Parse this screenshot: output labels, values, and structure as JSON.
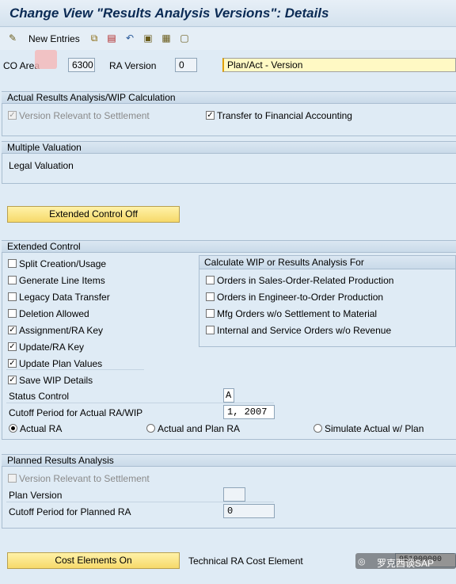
{
  "window": {
    "title": "Change View \"Results Analysis Versions\": Details"
  },
  "toolbar": {
    "new_entries_label": "New Entries",
    "icons": [
      "change-display-icon",
      "copy-icon",
      "delete-icon",
      "undo-icon",
      "select-all-icon",
      "select-block-icon",
      "deselect-icon"
    ]
  },
  "header": {
    "co_area_label": "CO Area",
    "co_area_value": "6300",
    "ra_version_label": "RA Version",
    "ra_version_value": "0",
    "version_desc": "Plan/Act - Version"
  },
  "actual_section": {
    "title": "Actual Results Analysis/WIP Calculation",
    "version_relevant_label": "Version Relevant to Settlement",
    "version_relevant_checked": true,
    "transfer_fi_label": "Transfer to Financial Accounting",
    "transfer_fi_checked": true
  },
  "multiple_valuation": {
    "title": "Multiple Valuation",
    "value": "Legal Valuation"
  },
  "extended_control_button": "Extended Control Off",
  "extended_control": {
    "title": "Extended Control",
    "items": [
      {
        "label": "Split Creation/Usage",
        "checked": false
      },
      {
        "label": "Generate Line Items",
        "checked": false
      },
      {
        "label": "Legacy Data Transfer",
        "checked": false
      },
      {
        "label": "Deletion Allowed",
        "checked": false
      },
      {
        "label": "Assignment/RA Key",
        "checked": true
      },
      {
        "label": "Update/RA Key",
        "checked": true
      },
      {
        "label": "Update Plan Values",
        "checked": true
      },
      {
        "label": "Save WIP Details",
        "checked": true
      }
    ],
    "calc_panel": {
      "title": "Calculate WIP or Results Analysis For",
      "items": [
        {
          "label": "Orders in Sales-Order-Related Production",
          "checked": false
        },
        {
          "label": "Orders in Engineer-to-Order Production",
          "checked": false
        },
        {
          "label": "Mfg Orders w/o Settlement to Material",
          "checked": false
        },
        {
          "label": "Internal and Service Orders w/o Revenue",
          "checked": false
        }
      ]
    },
    "status_control_label": "Status Control",
    "status_control_value": "A",
    "cutoff_label": "Cutoff Period for Actual RA/WIP",
    "cutoff_value": "1, 2007",
    "radios": [
      {
        "label": "Actual RA",
        "selected": true
      },
      {
        "label": "Actual and Plan RA",
        "selected": false
      },
      {
        "label": "Simulate Actual w/ Plan",
        "selected": false
      }
    ]
  },
  "planned_section": {
    "title": "Planned Results Analysis",
    "version_relevant_label": "Version Relevant to Settlement",
    "plan_version_label": "Plan Version",
    "plan_version_value": "",
    "cutoff_planned_label": "Cutoff Period for Planned RA",
    "cutoff_planned_value": "0"
  },
  "footer": {
    "cost_elements_button": "Cost Elements On",
    "tech_ra_label": "Technical RA Cost Element",
    "tech_ra_value": "951000000",
    "watermark_text": "罗克西谈SAP"
  }
}
